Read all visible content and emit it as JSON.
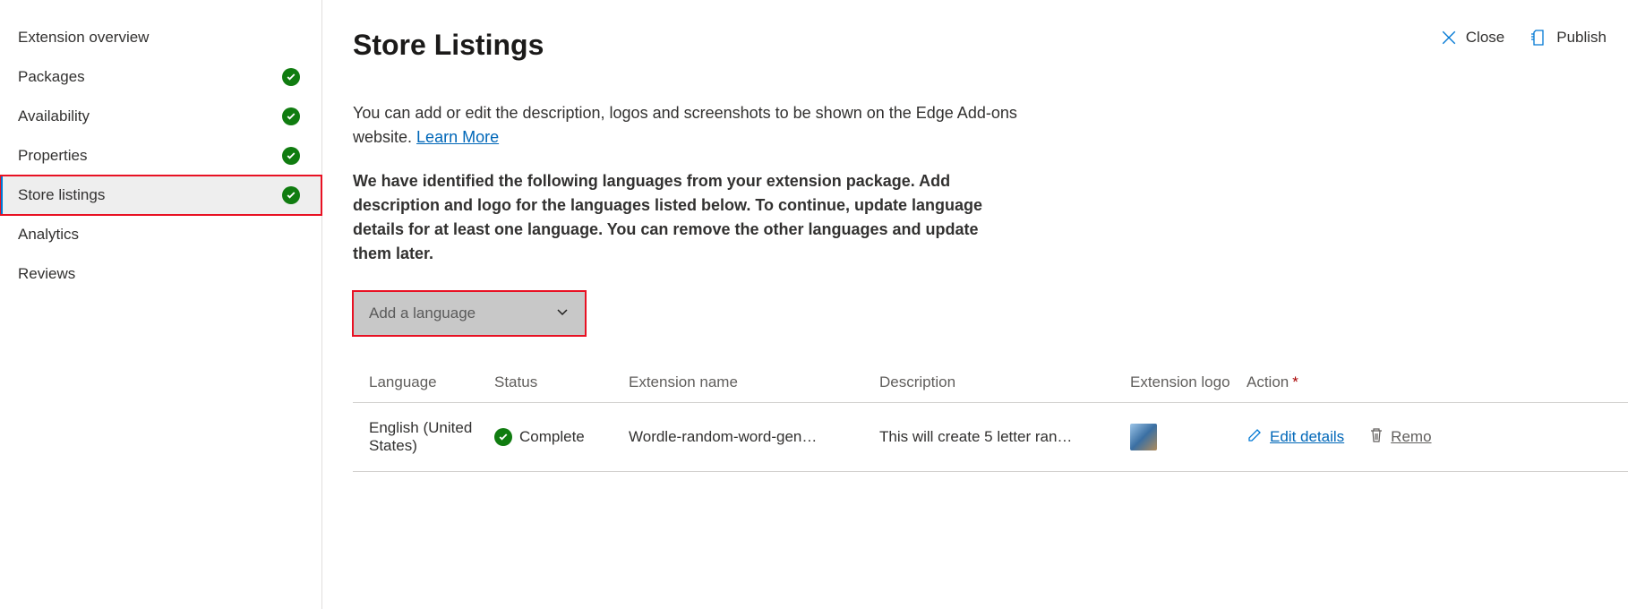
{
  "sidebar": {
    "items": [
      {
        "label": "Extension overview",
        "complete": false
      },
      {
        "label": "Packages",
        "complete": true
      },
      {
        "label": "Availability",
        "complete": true
      },
      {
        "label": "Properties",
        "complete": true
      },
      {
        "label": "Store listings",
        "complete": true,
        "active": true
      },
      {
        "label": "Analytics",
        "complete": false
      },
      {
        "label": "Reviews",
        "complete": false
      }
    ]
  },
  "header": {
    "title": "Store Listings",
    "close_label": "Close",
    "publish_label": "Publish"
  },
  "intro": {
    "text": "You can add or edit the description, logos and screenshots to be shown on the Edge Add-ons website. ",
    "link_label": "Learn More"
  },
  "notice": "We have identified the following languages from your extension package. Add description and logo for the languages listed below. To continue, update language details for at least one language. You can remove the other languages and update them later.",
  "dropdown": {
    "placeholder": "Add a language"
  },
  "table": {
    "headers": {
      "language": "Language",
      "status": "Status",
      "extension_name": "Extension name",
      "description": "Description",
      "logo": "Extension logo",
      "action": "Action"
    },
    "row": {
      "language": "English (United States)",
      "status": "Complete",
      "extension_name": "Wordle-random-word-gen…",
      "description": "This will create 5 letter ran…",
      "edit_label": "Edit details",
      "remove_label": "Remo"
    }
  }
}
